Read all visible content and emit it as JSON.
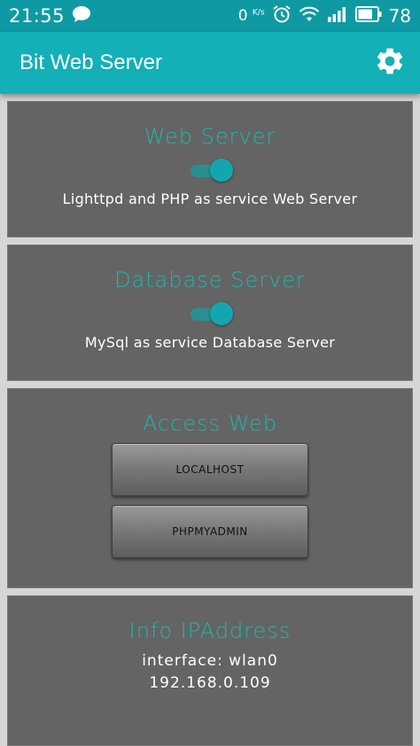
{
  "status_bar": {
    "time": "21:55",
    "net_speed_value": "0",
    "net_speed_unit": "K/s",
    "battery": "78",
    "icons": [
      "chat-bubble-icon",
      "alarm-clock-icon",
      "wifi-icon",
      "signal-icon",
      "battery-icon"
    ]
  },
  "app_bar": {
    "title": "Bit Web Server",
    "settings_icon": "gear-icon"
  },
  "colors": {
    "status_bar": "#0f9aa3",
    "app_bar": "#13b0b8",
    "accent": "#1bb8ad",
    "card_bg": "#646464",
    "page_bg": "#d6d6d6"
  },
  "web_server": {
    "title": "Web Server",
    "enabled": true,
    "description": "Lighttpd and PHP as service Web Server"
  },
  "database_server": {
    "title": "Database Server",
    "enabled": true,
    "description": "MySql as service Database Server"
  },
  "access_web": {
    "title": "Access Web",
    "buttons": [
      "LOCALHOST",
      "PHPMYADMIN"
    ]
  },
  "info": {
    "title": "Info IPAddress",
    "interface": "interface: wlan0",
    "ip": "192.168.0.109"
  }
}
